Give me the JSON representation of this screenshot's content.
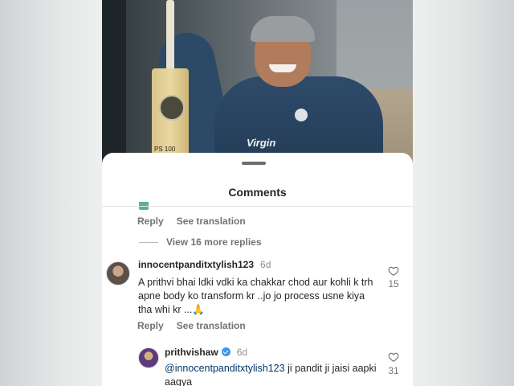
{
  "photo": {
    "bat_text": "PS 100",
    "sponsor": "Virgin"
  },
  "sheet": {
    "title": "Comments"
  },
  "prev_comment": {
    "reply_label": "Reply",
    "translate_label": "See translation"
  },
  "more_replies_label": "View 16 more replies",
  "comment": {
    "username": "innocentpanditxtylish123",
    "time": "6d",
    "text": "A prithvi bhai ldki vdki ka chakkar chod aur kohli k trh apne body ko transform kr ..jo jo process usne kiya tha whi kr ...🙏",
    "likes": "15",
    "reply_label": "Reply",
    "translate_label": "See translation"
  },
  "reply": {
    "username": "prithvishaw",
    "time": "6d",
    "mention": "@innocentpanditxtylish123",
    "text": " ji pandit ji jaisi aapki aagya",
    "likes": "31"
  },
  "icons": {
    "like": "heart-outline-icon",
    "verified": "verified-badge-icon"
  },
  "colors": {
    "verified": "#3897f0",
    "mention": "#00376b"
  }
}
